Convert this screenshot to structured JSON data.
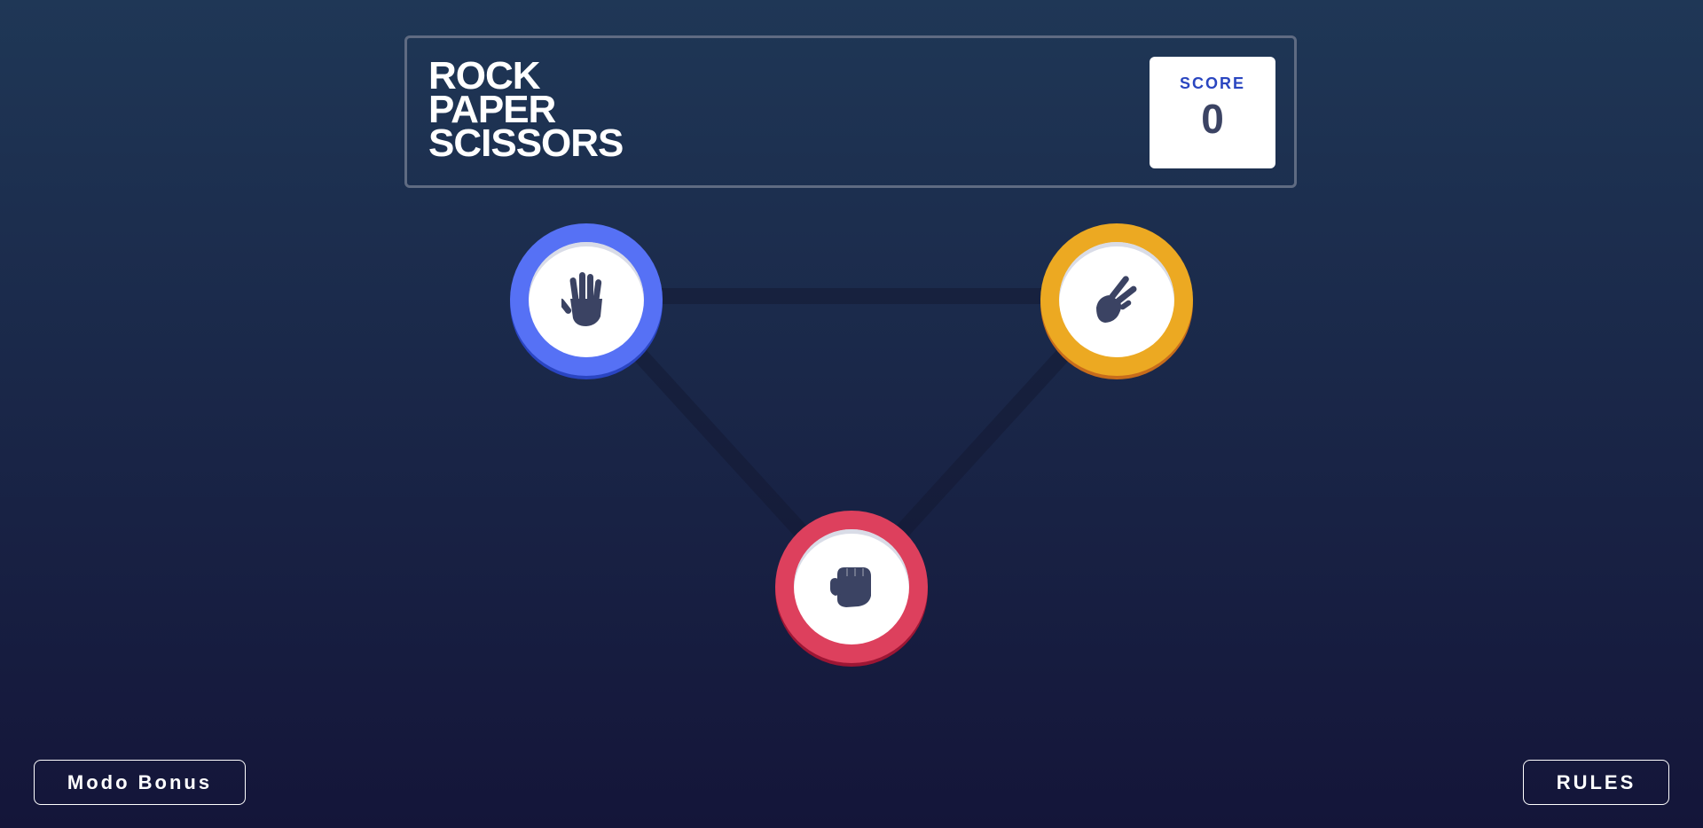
{
  "header": {
    "title_lines": [
      "ROCK",
      "PAPER",
      "SCISSORS"
    ],
    "score_label": "SCORE",
    "score_value": "0"
  },
  "choices": [
    {
      "id": "paper",
      "icon": "paper-hand-icon",
      "ring_color": "#5671f5"
    },
    {
      "id": "scissors",
      "icon": "scissors-hand-icon",
      "ring_color": "#eca922"
    },
    {
      "id": "rock",
      "icon": "rock-fist-icon",
      "ring_color": "#dd405d"
    }
  ],
  "buttons": {
    "bonus_label": "Modo Bonus",
    "rules_label": "RULES"
  },
  "colors": {
    "background_top": "#1f3756",
    "background_bottom": "#141539",
    "icon_color": "#3b4363",
    "score_label": "#2a46c0"
  }
}
